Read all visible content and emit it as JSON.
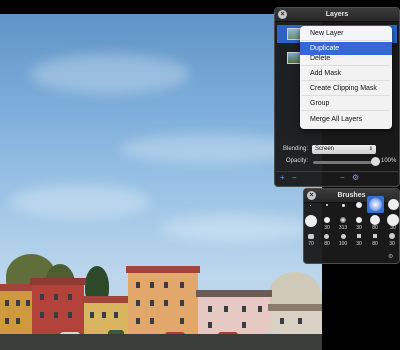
{
  "layers_panel": {
    "title": "Layers",
    "context_menu": [
      {
        "label": "New Layer",
        "highlighted": false
      },
      {
        "label": "Duplicate",
        "highlighted": true
      },
      {
        "label": "Delete",
        "highlighted": false
      },
      {
        "label": "Add Mask",
        "highlighted": false
      },
      {
        "label": "Create Clipping Mask",
        "highlighted": false
      },
      {
        "label": "Group",
        "highlighted": false
      },
      {
        "label": "Merge All Layers",
        "highlighted": false
      }
    ],
    "blending_label": "Blending:",
    "blending_value": "Screen",
    "opacity_label": "Opacity:",
    "opacity_value": "100%",
    "opacity_fraction": 1.0,
    "footer": {
      "add": "+",
      "remove": "−",
      "settings": "⚙"
    }
  },
  "brushes_panel": {
    "title": "Brushes",
    "sizes": [
      "30",
      "313",
      "30",
      "80",
      "30",
      "70",
      "80",
      "100",
      "30",
      "80",
      "30"
    ]
  },
  "colors": {
    "selection": "#2e62c8",
    "menu_highlight": "#3468d4",
    "panel_bg": "#1a1a1a"
  }
}
